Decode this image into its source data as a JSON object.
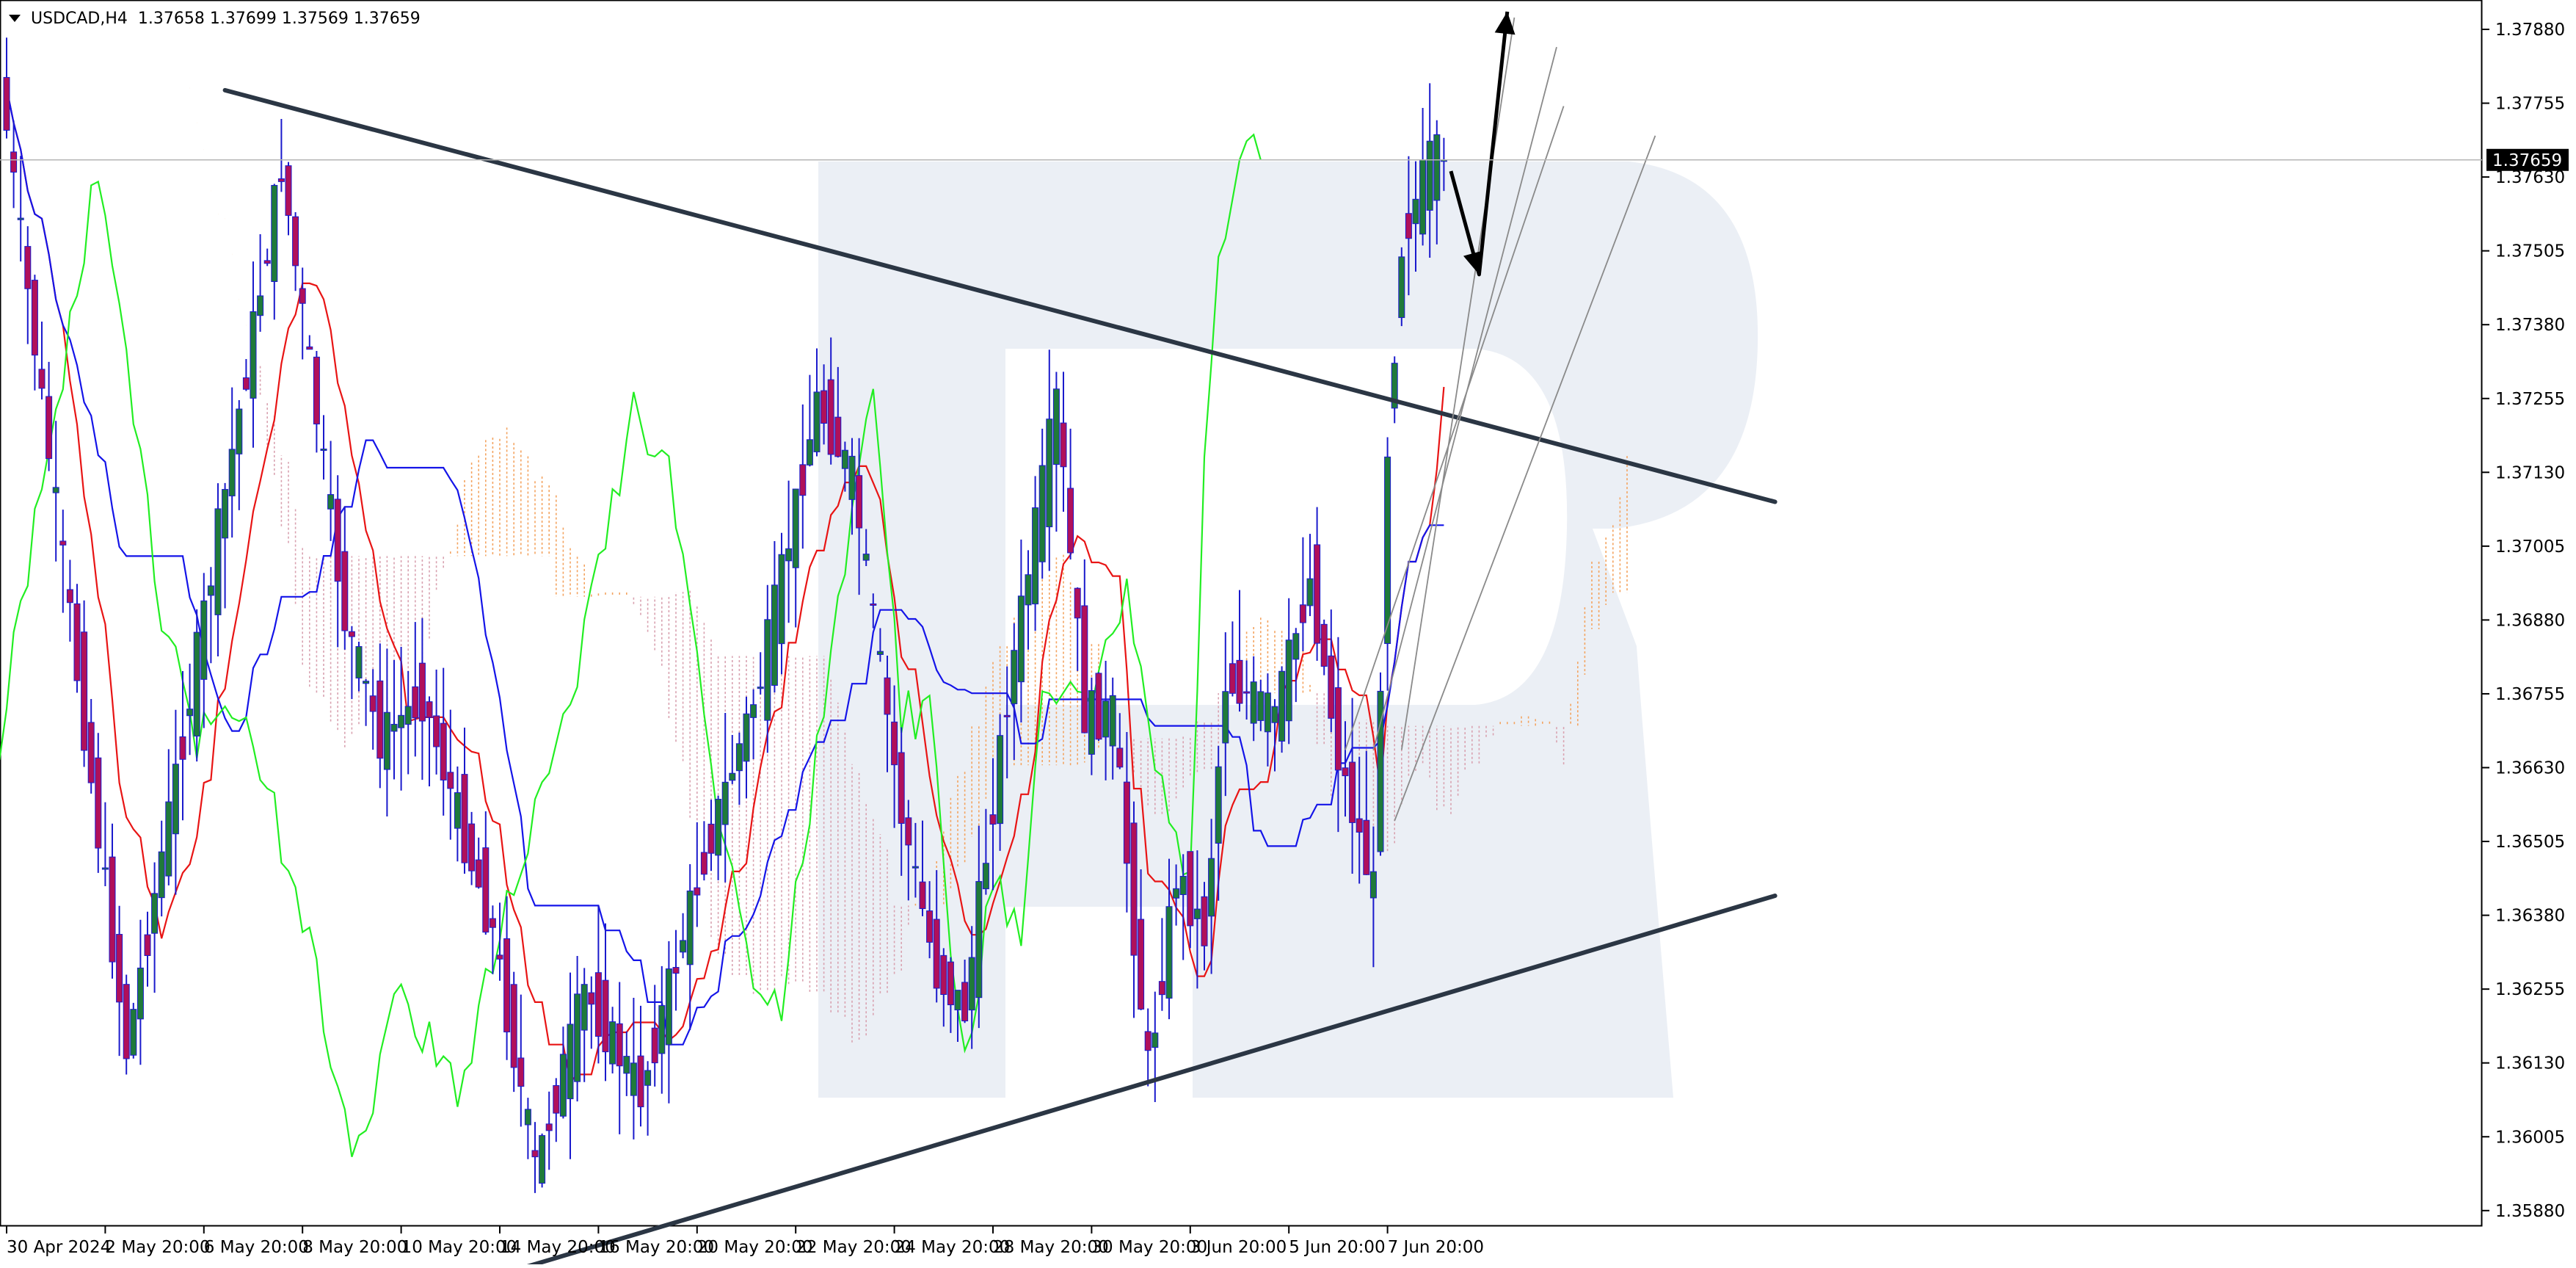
{
  "header": {
    "symbol": "USDCAD,H4",
    "ohlc": "1.37658 1.37699 1.37569 1.37659"
  },
  "current_price_label": "1.37659",
  "colors": {
    "bull_candle": "#1f7a3a",
    "bear_candle": "#b0105a",
    "wick": "#1a1acc",
    "tenkan": "#e81414",
    "kijun": "#1414e8",
    "chikou": "#22ee22",
    "kumo_bear": "#d9a2b0",
    "kumo_bull": "#f4a460",
    "trendlines": "#2b3644",
    "channel": "#8a8a8a",
    "arrow": "#000000",
    "watermark": "#e7ecf3"
  },
  "chart_data": {
    "type": "candlestick",
    "symbol": "USDCAD",
    "timeframe": "H4",
    "ylim": [
      1.3584,
      1.3791
    ],
    "y_ticks": [
      "1.37880",
      "1.37755",
      "1.37630",
      "1.37505",
      "1.37380",
      "1.37255",
      "1.37130",
      "1.37005",
      "1.36880",
      "1.36755",
      "1.36630",
      "1.36505",
      "1.36380",
      "1.36255",
      "1.36130",
      "1.36005",
      "1.35880"
    ],
    "x_labels": [
      "30 Apr 2024",
      "2 May 20:00",
      "6 May 20:00",
      "8 May 20:00",
      "10 May 20:00",
      "14 May 20:00",
      "16 May 20:00",
      "20 May 20:00",
      "22 May 20:00",
      "24 May 20:00",
      "28 May 20:00",
      "30 May 20:00",
      "3 Jun 20:00",
      "5 Jun 20:00",
      "7 Jun 20:00"
    ],
    "x_label_bars": [
      0,
      14,
      28,
      42,
      56,
      70,
      84,
      98,
      112,
      126,
      140,
      154,
      168,
      182,
      196
    ],
    "last_close": 1.37659,
    "key_points": [
      {
        "bar": 0,
        "price": 1.378
      },
      {
        "bar": 6,
        "price": 1.3725
      },
      {
        "bar": 18,
        "price": 1.3615
      },
      {
        "bar": 27,
        "price": 1.3675
      },
      {
        "bar": 40,
        "price": 1.3765
      },
      {
        "bar": 49,
        "price": 1.3688
      },
      {
        "bar": 54,
        "price": 1.3668
      },
      {
        "bar": 60,
        "price": 1.3675
      },
      {
        "bar": 70,
        "price": 1.3635
      },
      {
        "bar": 76,
        "price": 1.3595
      },
      {
        "bar": 83,
        "price": 1.3625
      },
      {
        "bar": 91,
        "price": 1.3608
      },
      {
        "bar": 100,
        "price": 1.3648
      },
      {
        "bar": 108,
        "price": 1.3678
      },
      {
        "bar": 116,
        "price": 1.3725
      },
      {
        "bar": 121,
        "price": 1.3712
      },
      {
        "bar": 128,
        "price": 1.3655
      },
      {
        "bar": 133,
        "price": 1.3628
      },
      {
        "bar": 137,
        "price": 1.3622
      },
      {
        "bar": 143,
        "price": 1.3675
      },
      {
        "bar": 150,
        "price": 1.3725
      },
      {
        "bar": 154,
        "price": 1.3672
      },
      {
        "bar": 158,
        "price": 1.3672
      },
      {
        "bar": 161,
        "price": 1.3635
      },
      {
        "bar": 163,
        "price": 1.3612
      },
      {
        "bar": 167,
        "price": 1.3645
      },
      {
        "bar": 171,
        "price": 1.3635
      },
      {
        "bar": 174,
        "price": 1.3678
      },
      {
        "bar": 181,
        "price": 1.3672
      },
      {
        "bar": 186,
        "price": 1.3695
      },
      {
        "bar": 190,
        "price": 1.3665
      },
      {
        "bar": 195,
        "price": 1.3642
      },
      {
        "bar": 197,
        "price": 1.3718
      },
      {
        "bar": 199,
        "price": 1.3752
      },
      {
        "bar": 203,
        "price": 1.3766
      }
    ],
    "trendlines": [
      {
        "name": "upper",
        "from": {
          "bar": 31,
          "price": 1.37777
        },
        "to": {
          "bar": 251,
          "price": 1.3708
        }
      },
      {
        "name": "lower",
        "from": {
          "bar": 47,
          "price": 1.3569
        },
        "to": {
          "bar": 251,
          "price": 1.36413
        }
      }
    ],
    "forecast_arrow": [
      {
        "bar": 205,
        "price": 1.3764
      },
      {
        "bar": 209,
        "price": 1.37465
      },
      {
        "bar": 213,
        "price": 1.3791
      }
    ]
  }
}
